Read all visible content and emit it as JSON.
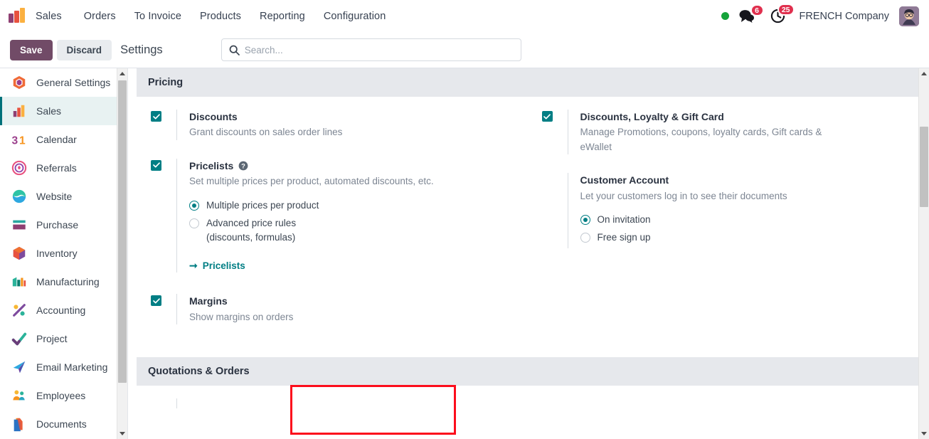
{
  "navbar": {
    "brand": "Sales",
    "logo_icon": "sales-bars-logo",
    "menu": [
      {
        "label": "Orders"
      },
      {
        "label": "To Invoice"
      },
      {
        "label": "Products"
      },
      {
        "label": "Reporting"
      },
      {
        "label": "Configuration"
      }
    ],
    "presence_dot": {
      "icon": "presence-online-dot",
      "color": "#15a33a"
    },
    "messages": {
      "icon": "messages-bubble-icon",
      "badge": "6"
    },
    "activities": {
      "icon": "activities-clock-icon",
      "badge": "25"
    },
    "company": "FRENCH Company",
    "avatar": {
      "icon": "user-avatar"
    },
    "badge_color": "#e0304e"
  },
  "control_panel": {
    "save_label": "Save",
    "discard_label": "Discard",
    "title": "Settings",
    "save_color": "#714b67"
  },
  "search": {
    "icon": "search-icon",
    "placeholder": "Search...",
    "value": ""
  },
  "sidebar": {
    "items": [
      {
        "label": "General Settings",
        "icon": "general-settings-icon",
        "active": false
      },
      {
        "label": "Sales",
        "icon": "sales-icon",
        "active": true
      },
      {
        "label": "Calendar",
        "icon": "calendar-icon",
        "active": false
      },
      {
        "label": "Referrals",
        "icon": "referrals-icon",
        "active": false
      },
      {
        "label": "Website",
        "icon": "website-icon",
        "active": false
      },
      {
        "label": "Purchase",
        "icon": "purchase-icon",
        "active": false
      },
      {
        "label": "Inventory",
        "icon": "inventory-icon",
        "active": false
      },
      {
        "label": "Manufacturing",
        "icon": "manufacturing-icon",
        "active": false
      },
      {
        "label": "Accounting",
        "icon": "accounting-icon",
        "active": false
      },
      {
        "label": "Project",
        "icon": "project-icon",
        "active": false
      },
      {
        "label": "Email Marketing",
        "icon": "email-marketing-icon",
        "active": false
      },
      {
        "label": "Employees",
        "icon": "employees-icon",
        "active": false
      },
      {
        "label": "Documents",
        "icon": "documents-icon",
        "active": false
      }
    ]
  },
  "settings": {
    "sections": [
      {
        "title": "Pricing"
      },
      {
        "title": "Quotations & Orders"
      }
    ],
    "pricing": {
      "left": {
        "discounts": {
          "title": "Discounts",
          "desc": "Grant discounts on sales order lines",
          "checked": true
        },
        "pricelists": {
          "title": "Pricelists",
          "help_icon": "help-question-icon",
          "desc": "Set multiple prices per product, automated discounts, etc.",
          "checked": true,
          "options": [
            {
              "label": "Multiple prices per product",
              "selected": true
            },
            {
              "label": "Advanced price rules\n(discounts, formulas)",
              "selected": false
            }
          ],
          "link": "Pricelists",
          "link_icon": "arrow-right-icon"
        },
        "margins": {
          "title": "Margins",
          "desc": "Show margins on orders",
          "checked": true,
          "highlighted": true,
          "highlight_color": "#fc0d1c"
        }
      },
      "right": {
        "loyalty": {
          "title": "Discounts, Loyalty & Gift Card",
          "desc": "Manage Promotions, coupons, loyalty cards, Gift cards & eWallet",
          "checked": true
        },
        "customer_account": {
          "title": "Customer Account",
          "desc": "Let your customers log in to see their documents",
          "options": [
            {
              "label": "On invitation",
              "selected": true
            },
            {
              "label": "Free sign up",
              "selected": false
            }
          ]
        }
      }
    },
    "accent_color": "#017e84"
  }
}
